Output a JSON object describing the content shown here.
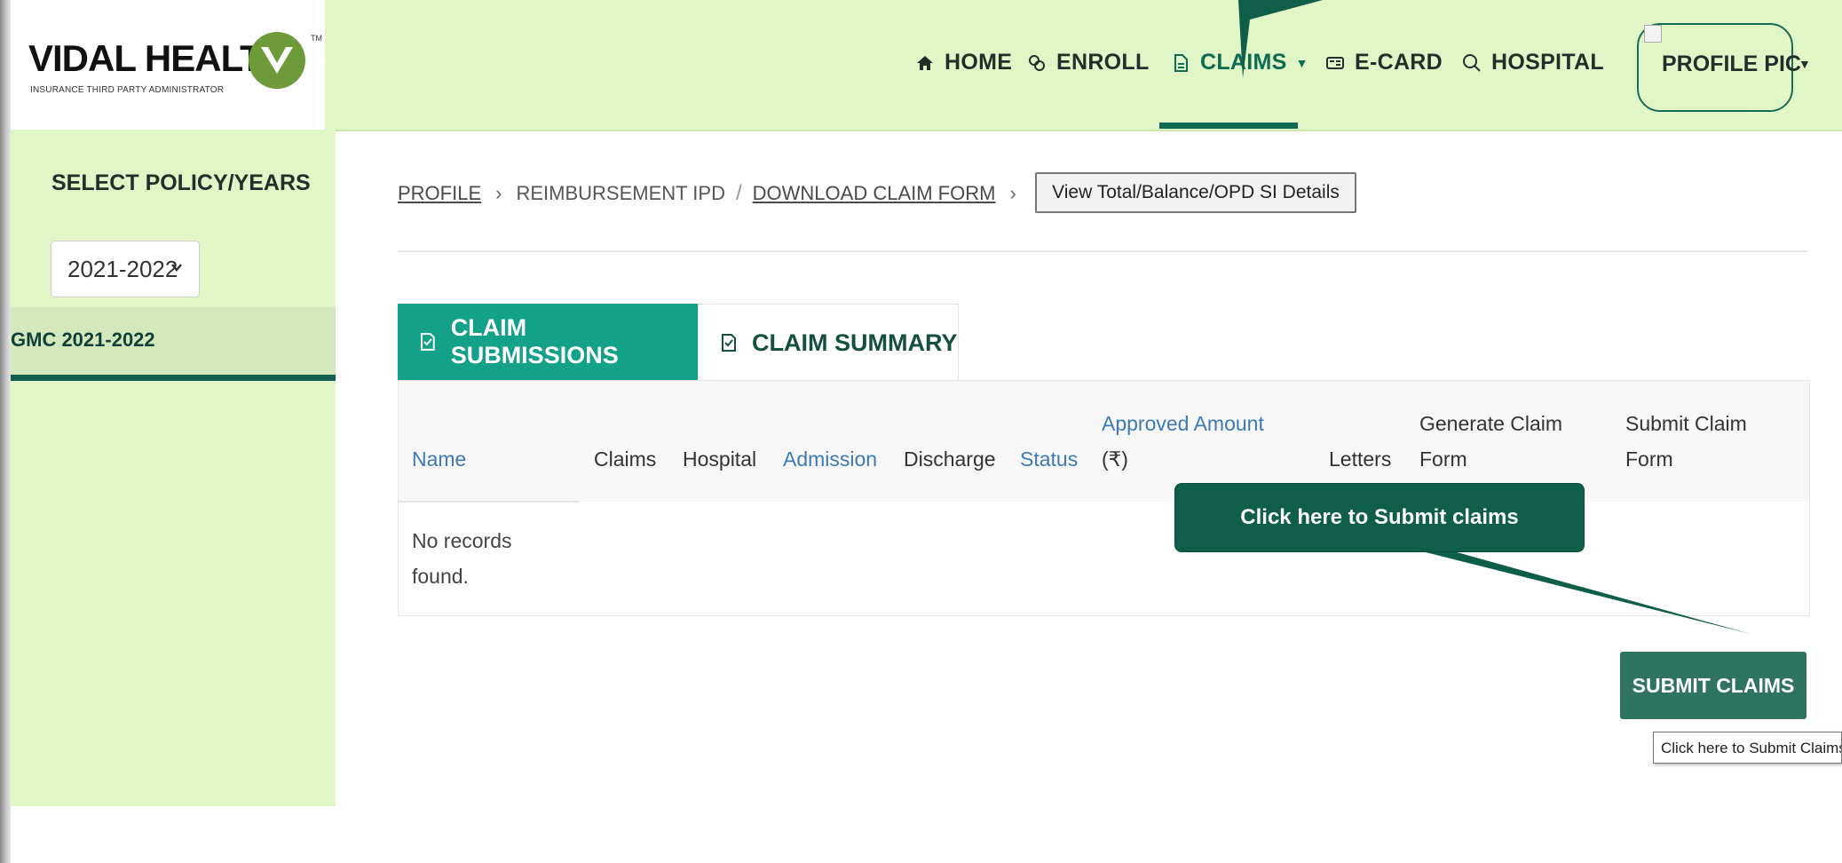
{
  "logo": {
    "text": "VIDAL HEALTH",
    "subtitle": "INSURANCE THIRD PARTY ADMINISTRATOR",
    "tm": "TM"
  },
  "nav": {
    "items": [
      {
        "label": "HOME",
        "icon": "home-icon"
      },
      {
        "label": "ENROLL",
        "icon": "enroll-icon"
      },
      {
        "label": "CLAIMS",
        "icon": "document-icon",
        "active": true
      },
      {
        "label": "E-CARD",
        "icon": "card-icon"
      },
      {
        "label": "HOSPITAL",
        "icon": "search-icon"
      }
    ],
    "profile_label": "PROFILE PIC"
  },
  "sidebar": {
    "title": "SELECT POLICY/YEARS",
    "year_selected": "2021-2022",
    "policy_item": "GMC 2021-2022"
  },
  "breadcrumb": {
    "profile": "PROFILE",
    "reimbursement": "REIMBURSEMENT IPD",
    "download": "DOWNLOAD CLAIM FORM"
  },
  "view_details_button": "View Total/Balance/OPD SI Details",
  "tabs": {
    "submissions": "CLAIM SUBMISSIONS",
    "summary": "CLAIM SUMMARY"
  },
  "table": {
    "headers": {
      "name": "Name",
      "claims": "Claims",
      "hospital": "Hospital",
      "admission": "Admission",
      "discharge": "Discharge",
      "status": "Status",
      "approved_line1": "Approved Amount",
      "approved_line2": "(₹)",
      "letters": "Letters",
      "generate_line1": "Generate Claim",
      "generate_line2": "Form",
      "submit_line1": "Submit Claim",
      "submit_line2": "Form"
    },
    "empty_line1": "No records",
    "empty_line2": "found."
  },
  "callout_text": "Click here to Submit claims",
  "submit_button": "SUBMIT CLAIMS",
  "tooltip": "Click here to Submit Claims",
  "colors": {
    "nav_bg": "#e1f6c7",
    "accent": "#0d6a53",
    "tab_active": "#14a18a",
    "callout": "#0e5e49"
  }
}
